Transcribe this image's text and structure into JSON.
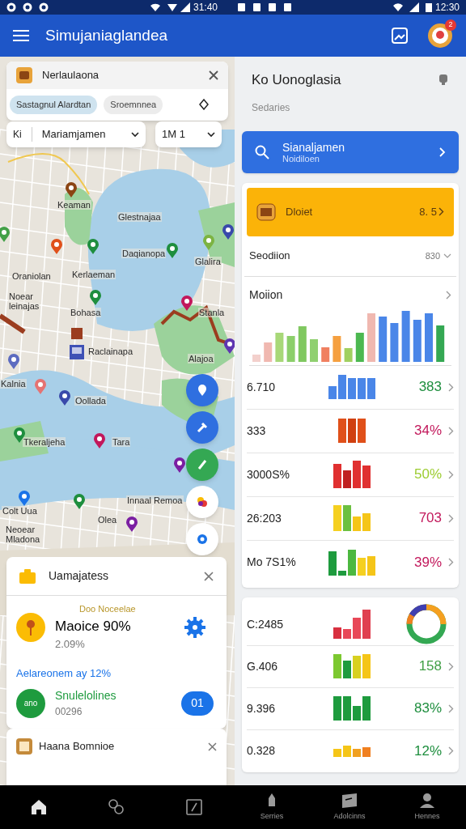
{
  "status_bar": {
    "time_left": "31:40",
    "time_right": "12:30"
  },
  "app_bar": {
    "title": "Simujaniaglandea",
    "notification_badge": "2"
  },
  "map": {
    "place_card": {
      "title": "Nerlaulaona",
      "chips": [
        {
          "label": "Sastagnul Alardtan",
          "selected": true
        },
        {
          "label": "Sroemnnea",
          "selected": false
        }
      ]
    },
    "filters": [
      {
        "prefix": "Ki",
        "value": "Mariamjamen"
      },
      {
        "value": "1M 1"
      }
    ],
    "labels": [
      "Keaman",
      "Glestnajaa",
      "Daqianopa",
      "Glalira",
      "Oraniolan",
      "Kerlaeman",
      "Noear\nleinajas",
      "Bohasa",
      "Stanla",
      "Raclainapa",
      "Kalnia",
      "Oollada",
      "Tkeraljeha",
      "Tara",
      "Innaal Remoa",
      "Olea",
      "Colt Uua",
      "Neoear\nMladona",
      "Alajoa"
    ]
  },
  "info_card": {
    "title": "Uamajatess",
    "eyebrow": "Doo Noceelae",
    "headline": "Maoice 90%",
    "sub": "2.09%",
    "link": "Aelareonem ay 12%",
    "second_title": "Snulelolines",
    "second_sub": "00296",
    "avatar_text": "ano",
    "badge": "01"
  },
  "bottom_card": {
    "title": "Haana Bomnioe"
  },
  "panel": {
    "title": "Ko Uonoglasia",
    "subtitle": "Sedaries",
    "primary_button": {
      "title": "Sianaljamen",
      "subtitle": "Noidiloen"
    },
    "highlight": {
      "title": "Dloiet",
      "value": "8. 5"
    },
    "select_row": {
      "label": "Seodiion",
      "value": "830"
    },
    "chart_row": {
      "title": "Moiion"
    },
    "rows": [
      {
        "label": "6.710",
        "value": "383",
        "color": "#1e8e3e"
      },
      {
        "label": "333",
        "value": "34%",
        "color": "#c2185b"
      },
      {
        "label": "3000S%",
        "value": "50%",
        "color": "#9ccc30"
      },
      {
        "label": "26:203",
        "value": "703",
        "color": "#c2185b"
      },
      {
        "label": "Mo 7S1%",
        "value": "39%",
        "color": "#c2185b"
      }
    ],
    "rows_2": [
      {
        "label": "C:2485"
      },
      {
        "label": "G.406",
        "value": "158",
        "color": "#43a047"
      },
      {
        "label": "9.396",
        "value": "83%",
        "color": "#1e8e3e"
      },
      {
        "label": "0.328",
        "value": "12%",
        "color": "#1e8e3e"
      }
    ]
  },
  "bottom_nav": [
    {
      "selected": true
    },
    {
      "selected": false
    },
    {
      "selected": false
    },
    {
      "label": "Serries",
      "selected": false
    },
    {
      "label": "Adolcinns",
      "selected": false
    },
    {
      "label": "Hennes",
      "selected": false
    }
  ]
}
